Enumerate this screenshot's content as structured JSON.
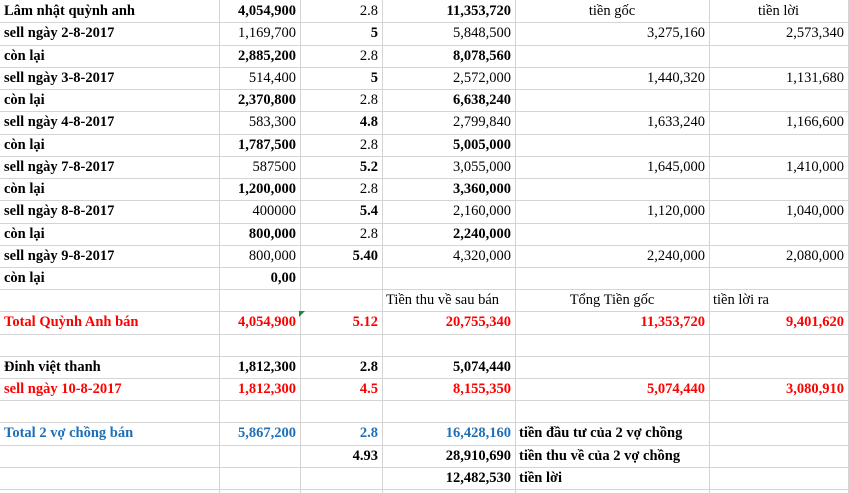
{
  "rows": [
    {
      "a": "Lâm nhật quỳnh anh",
      "b": "4,054,900",
      "c": "2.8",
      "d": "11,353,720",
      "e": "tiền gốc",
      "f": "tiền lời"
    },
    {
      "a": "sell  ngày 2-8-2017",
      "b": "1,169,700",
      "c": "5",
      "d": "5,848,500",
      "e": "3,275,160",
      "f": "2,573,340"
    },
    {
      "a": "còn lại",
      "b": "2,885,200",
      "c": "2.8",
      "d": "8,078,560",
      "e": "",
      "f": ""
    },
    {
      "a": "sell ngày 3-8-2017",
      "b": "514,400",
      "c": "5",
      "d": "2,572,000",
      "e": "1,440,320",
      "f": "1,131,680"
    },
    {
      "a": "còn lại",
      "b": "2,370,800",
      "c": "2.8",
      "d": "6,638,240",
      "e": "",
      "f": ""
    },
    {
      "a": "sell ngày 4-8-2017",
      "b": "583,300",
      "c": "4.8",
      "d": "2,799,840",
      "e": "1,633,240",
      "f": "1,166,600"
    },
    {
      "a": "còn lại",
      "b": "1,787,500",
      "c": "2.8",
      "d": "5,005,000",
      "e": "",
      "f": ""
    },
    {
      "a": "sell ngày 7-8-2017",
      "b": "587500",
      "c": "5.2",
      "d": "3,055,000",
      "e": "1,645,000",
      "f": "1,410,000"
    },
    {
      "a": "còn lại",
      "b": "1,200,000",
      "c": "2.8",
      "d": "3,360,000",
      "e": "",
      "f": ""
    },
    {
      "a": "sell ngày 8-8-2017",
      "b": "400000",
      "c": "5.4",
      "d": "2,160,000",
      "e": "1,120,000",
      "f": "1,040,000"
    },
    {
      "a": "còn lại",
      "b": "800,000",
      "c": "2.8",
      "d": "2,240,000",
      "e": "",
      "f": ""
    },
    {
      "a": "sell ngày 9-8-2017",
      "b": "800,000",
      "c": "5.40",
      "d": "4,320,000",
      "e": "2,240,000",
      "f": "2,080,000"
    },
    {
      "a": "còn lại",
      "b": "0,00",
      "c": "",
      "d": "",
      "e": "",
      "f": ""
    },
    {
      "a": "",
      "b": "",
      "c": "",
      "d": "Tiền thu về sau bán",
      "e": "Tổng Tiền gốc",
      "f": "tiền lời ra"
    },
    {
      "a": "Total Quỳnh Anh bán",
      "b": "4,054,900",
      "c": "5.12",
      "d": "20,755,340",
      "e": "11,353,720",
      "f": "9,401,620"
    },
    {
      "a": "",
      "b": "",
      "c": "",
      "d": "",
      "e": "",
      "f": ""
    },
    {
      "a": "Đinh việt thanh",
      "b": "1,812,300",
      "c": "2.8",
      "d": "5,074,440",
      "e": "",
      "f": ""
    },
    {
      "a": "sell ngày 10-8-2017",
      "b": "1,812,300",
      "c": "4.5",
      "d": "8,155,350",
      "e": "5,074,440",
      "f": "3,080,910"
    },
    {
      "a": "",
      "b": "",
      "c": "",
      "d": "",
      "e": "",
      "f": ""
    },
    {
      "a": "Total 2 vợ chồng bán",
      "b": "5,867,200",
      "c": "2.8",
      "d": "16,428,160",
      "e": "tiền đầu tư của 2 vợ chồng",
      "f": ""
    },
    {
      "a": "",
      "b": "",
      "c": "4.93",
      "d": "28,910,690",
      "e": "tiền thu về của 2 vợ chồng",
      "f": ""
    },
    {
      "a": "",
      "b": "",
      "c": "",
      "d": "12,482,530",
      "e": "tiền lời",
      "f": ""
    }
  ],
  "colors": {
    "grid": "#d4d4d4",
    "red": "#ff0000",
    "blue": "#1f6fb7",
    "note_marker": "#1a8a3a"
  }
}
